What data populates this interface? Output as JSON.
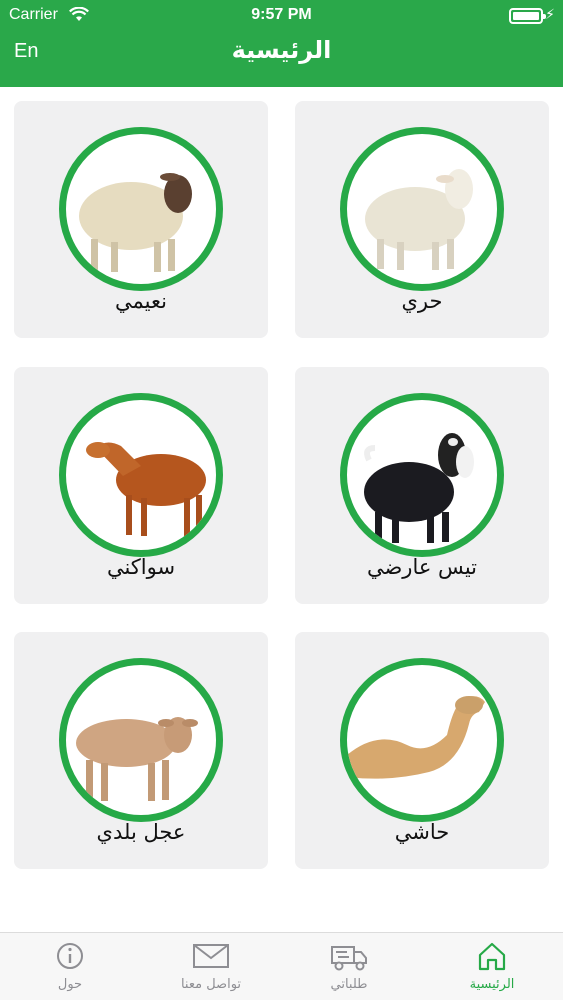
{
  "status_bar": {
    "carrier": "Carrier",
    "time": "9:57 PM"
  },
  "header": {
    "language_toggle": "En",
    "title": "الرئيسية"
  },
  "categories": [
    {
      "label": "حري",
      "image": "sheep-white-icon"
    },
    {
      "label": "نعيمي",
      "image": "sheep-naimi-icon"
    },
    {
      "label": "تيس عارضي",
      "image": "goat-black-icon"
    },
    {
      "label": "سواكني",
      "image": "sheep-brown-icon"
    },
    {
      "label": "حاشي",
      "image": "camel-icon"
    },
    {
      "label": "عجل بلدي",
      "image": "calf-icon"
    }
  ],
  "tabbar": {
    "home": "الرئيسية",
    "orders": "طلباتي",
    "contact": "تواصل معنا",
    "about": "حول"
  },
  "colors": {
    "accent": "#2aa84a",
    "card_bg": "#f0f0f1",
    "tab_inactive": "#8e8e93"
  }
}
